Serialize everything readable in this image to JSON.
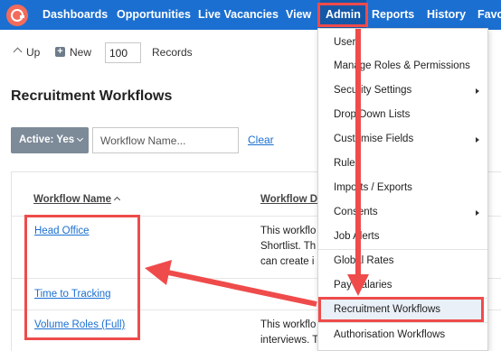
{
  "nav": {
    "items": [
      "Dashboards",
      "Opportunities",
      "Live Vacancies",
      "View",
      "Admin",
      "Reports",
      "History",
      "Favo"
    ],
    "active": "Admin"
  },
  "toolbar": {
    "up_label": "Up",
    "new_label": "New",
    "records_value": "100",
    "records_label": "Records"
  },
  "page": {
    "title": "Recruitment Workflows"
  },
  "filter": {
    "active_label": "Active: Yes",
    "workflow_placeholder": "Workflow Name...",
    "clear_label": "Clear"
  },
  "table": {
    "headers": {
      "name": "Workflow Name",
      "desc": "Workflow De"
    },
    "rows": [
      {
        "name": "Head Office",
        "desc": [
          "This workflo",
          "Shortlist. Th",
          "can create i"
        ]
      },
      {
        "name": "Time to Tracking",
        "desc": [
          ""
        ]
      },
      {
        "name": "Volume Roles (Full)",
        "desc": [
          "This workflo",
          "interviews. T"
        ]
      }
    ]
  },
  "admin_menu": {
    "items": [
      {
        "label": "Users"
      },
      {
        "label": "Manage Roles & Permissions"
      },
      {
        "label": "Security Settings",
        "submenu": true
      },
      {
        "label": "Drop Down Lists"
      },
      {
        "label": "Customise Fields",
        "submenu": true
      },
      {
        "label": "Rules"
      },
      {
        "label": "Imports / Exports"
      },
      {
        "label": "Consents",
        "submenu": true
      },
      {
        "label": "Job Alerts"
      },
      {
        "label": "Global Rates"
      },
      {
        "label": "Pay Salaries"
      },
      {
        "label": "Recruitment Workflows",
        "highlighted": true
      },
      {
        "label": "Authorisation Workflows"
      }
    ]
  },
  "colors": {
    "nav_bg": "#1b6fd1",
    "annotation_red": "#ef4b4b",
    "link_blue": "#1b6fd1",
    "filter_button": "#7d8a98"
  }
}
